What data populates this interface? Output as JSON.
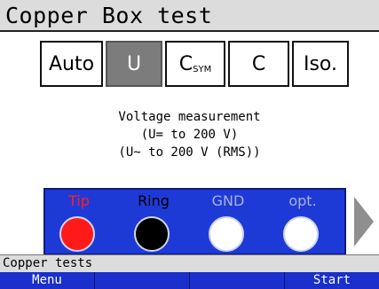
{
  "title": "Copper Box test",
  "modes": [
    {
      "label": "Auto",
      "sub": ""
    },
    {
      "label": "U",
      "sub": ""
    },
    {
      "label": "C",
      "sub": "SYM"
    },
    {
      "label": "C",
      "sub": ""
    },
    {
      "label": "Iso.",
      "sub": ""
    }
  ],
  "active_mode": "U",
  "description": {
    "line1": "Voltage measurement",
    "line2": "(U= to 200 V)",
    "line3": "(U~ to 200 V (RMS))"
  },
  "connectors": [
    {
      "label": "Tip",
      "color": "#ff1a1a",
      "label_color": "#ff2020"
    },
    {
      "label": "Ring",
      "color": "#000000",
      "label_color": "#000000"
    },
    {
      "label": "GND",
      "color": "#ffffff",
      "label_color": "#a8b0e0"
    },
    {
      "label": "opt.",
      "color": "#ffffff",
      "label_color": "#a8b0e0"
    }
  ],
  "status": "Copper tests",
  "softkeys": [
    "Menu",
    "",
    "",
    "Start"
  ],
  "colors": {
    "softkey_bar": "#1a2fcc",
    "connector_panel": "#1e3ad6",
    "active_mode_bg": "#7c7c7c"
  }
}
